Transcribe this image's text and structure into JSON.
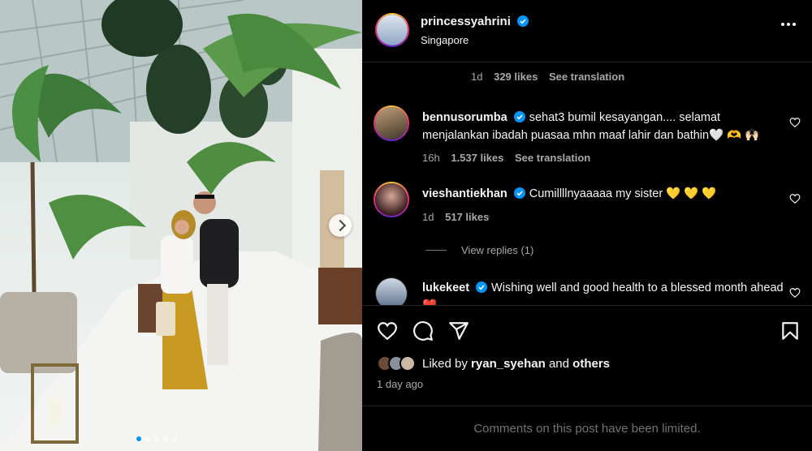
{
  "post": {
    "author": "princessyahrini",
    "location": "Singapore",
    "caption_meta": {
      "age": "1d",
      "likes": "329 likes",
      "translate": "See translation"
    }
  },
  "comments": [
    {
      "username": "bennusorumba",
      "text": "sehat3 bumil kesayangan.... selamat menjalankan ibadah puasaa mhn maaf lahir dan bathin🤍 🫶 🙌🏻",
      "age": "16h",
      "likes": "1.537 likes",
      "translate": "See translation"
    },
    {
      "username": "vieshantiekhan",
      "text": "Cumillllnyaaaaa my sister 💛 💛 💛",
      "age": "1d",
      "likes": "517 likes",
      "view_replies": "View replies (1)"
    },
    {
      "username": "lukekeet",
      "text": "Wishing well and good health to a blessed month ahead ❤️"
    }
  ],
  "likes_summary": {
    "prefix": "Liked by",
    "user": "ryan_syehan",
    "connector": "and",
    "others": "others"
  },
  "timestamp": "1 day ago",
  "footer_notice": "Comments on this post have been limited.",
  "icons": {
    "like": "heart-icon",
    "comment": "comment-icon",
    "share": "send-icon",
    "save": "bookmark-icon",
    "more": "more-options-icon",
    "verified": "verified-badge-icon"
  },
  "colors": {
    "verified": "#0095f6",
    "accent_dot": "#0095f6",
    "background": "#000000",
    "muted": "#a8a8a8"
  }
}
